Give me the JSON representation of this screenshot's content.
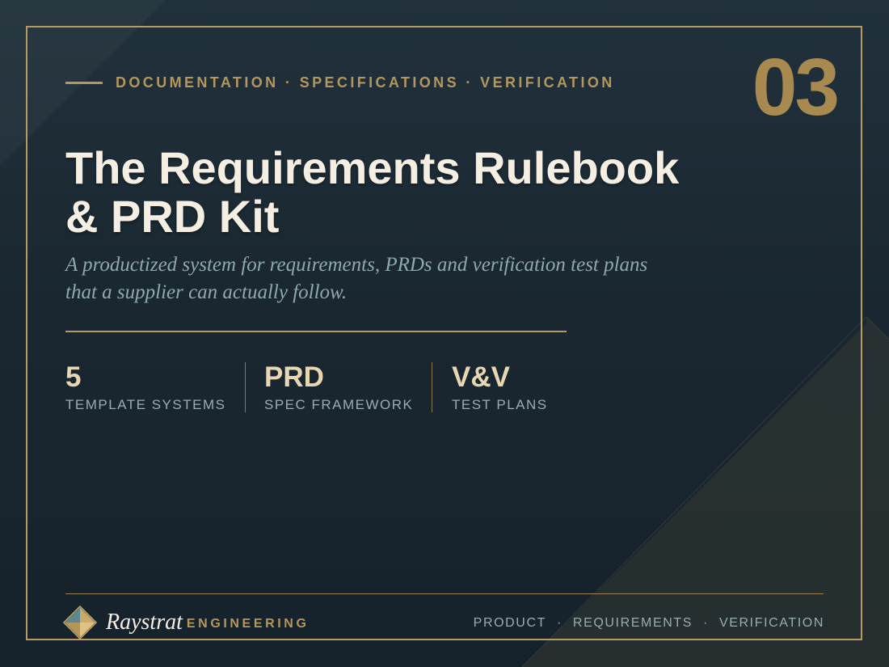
{
  "colors": {
    "background": "#1a2731",
    "accent_gold": "#b79a62",
    "title_text": "#f4eee3",
    "subtitle_text": "#8ea9b0",
    "stat_value": "#e7d6b2",
    "muted_text": "#98adb2"
  },
  "header": {
    "eyebrow": "DOCUMENTATION · SPECIFICATIONS · VERIFICATION",
    "slide_number": "03"
  },
  "hero": {
    "title_line1": "The Requirements Rulebook",
    "title_line2": "& PRD Kit",
    "subtitle_line1": "A productized system for requirements, PRDs and verification test plans",
    "subtitle_line2": "that a supplier can actually follow."
  },
  "stats": [
    {
      "value": "5",
      "label": "TEMPLATE SYSTEMS"
    },
    {
      "value": "PRD",
      "label": "SPEC FRAMEWORK"
    },
    {
      "value": "V&V",
      "label": "TEST PLANS"
    }
  ],
  "footer": {
    "brand_name": "Raystrat",
    "brand_tag": "ENGINEERING",
    "logo_icon": "diamond-logo-icon",
    "nav": [
      "PRODUCT",
      "REQUIREMENTS",
      "VERIFICATION"
    ],
    "nav_separator": "·"
  }
}
